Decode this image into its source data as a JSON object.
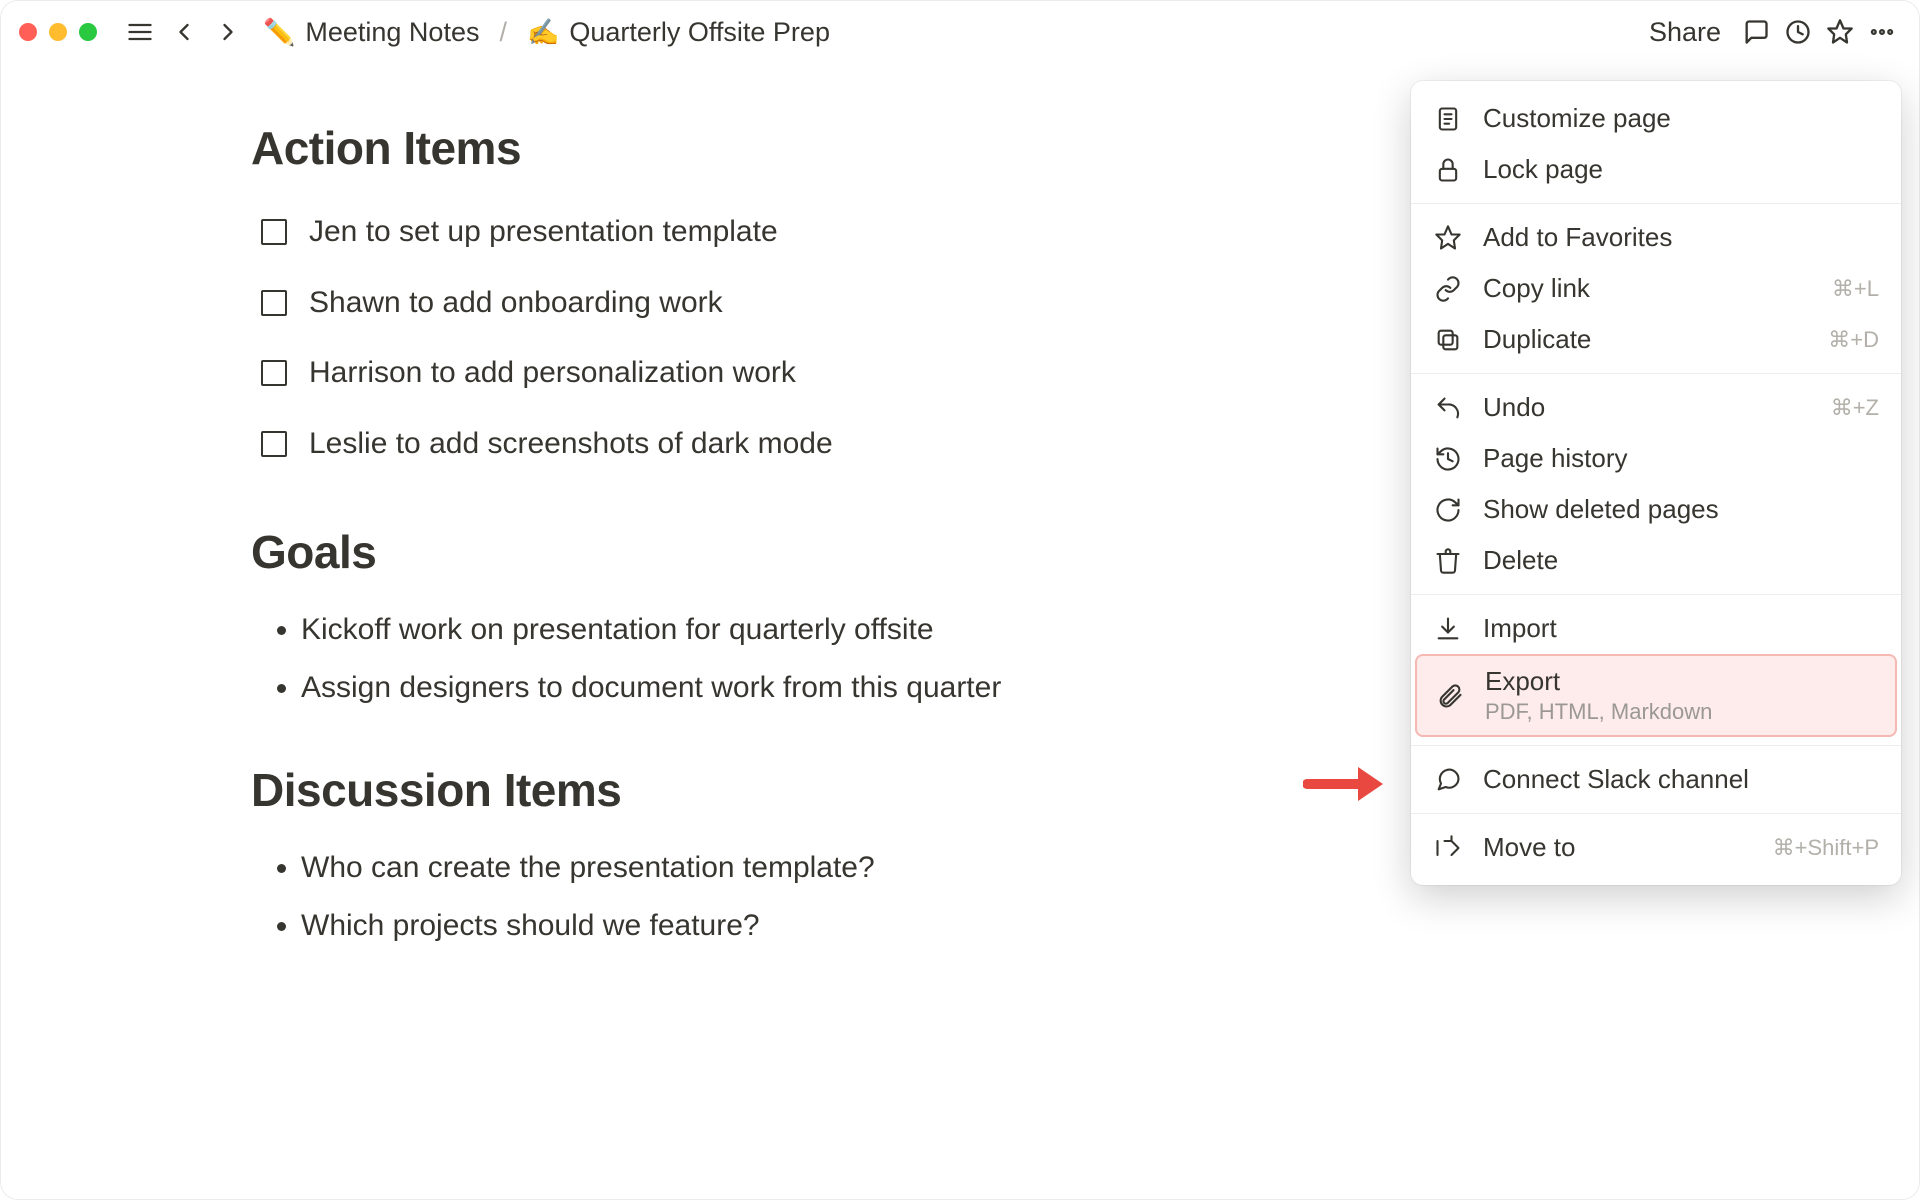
{
  "breadcrumb": {
    "parent_emoji": "✏️",
    "parent": "Meeting Notes",
    "sep": "/",
    "page_emoji": "✍️",
    "page": "Quarterly Offsite Prep"
  },
  "toolbar": {
    "share": "Share"
  },
  "sections": {
    "action_items": {
      "title": "Action Items",
      "items": [
        "Jen to set up presentation template",
        "Shawn to add onboarding work",
        "Harrison to add personalization work",
        "Leslie to add screenshots of dark mode"
      ]
    },
    "goals": {
      "title": "Goals",
      "items": [
        "Kickoff work on presentation for quarterly offsite",
        "Assign designers to document work from this quarter"
      ]
    },
    "discussion": {
      "title": "Discussion Items",
      "items": [
        "Who can create the presentation template?",
        "Which projects should we feature?"
      ]
    }
  },
  "menu": {
    "customize": "Customize page",
    "lock": "Lock page",
    "favorite": "Add to Favorites",
    "copylink": "Copy link",
    "copylink_kbd": "⌘+L",
    "duplicate": "Duplicate",
    "duplicate_kbd": "⌘+D",
    "undo": "Undo",
    "undo_kbd": "⌘+Z",
    "history": "Page history",
    "deleted": "Show deleted pages",
    "delete": "Delete",
    "import": "Import",
    "export": "Export",
    "export_sub": "PDF, HTML, Markdown",
    "slack": "Connect Slack channel",
    "move": "Move to",
    "move_kbd": "⌘+Shift+P"
  }
}
